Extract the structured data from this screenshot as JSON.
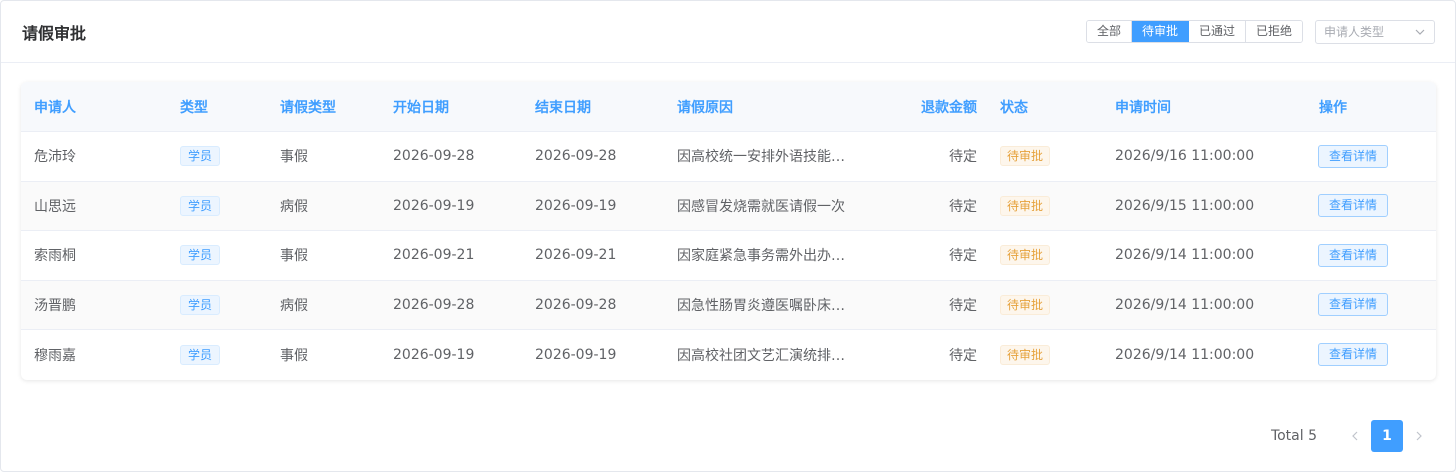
{
  "header": {
    "title": "请假审批",
    "filters": [
      {
        "label": "全部",
        "active": false
      },
      {
        "label": "待审批",
        "active": true
      },
      {
        "label": "已通过",
        "active": false
      },
      {
        "label": "已拒绝",
        "active": false
      }
    ],
    "select_placeholder": "申请人类型"
  },
  "table": {
    "columns": [
      "申请人",
      "类型",
      "请假类型",
      "开始日期",
      "结束日期",
      "请假原因",
      "退款金额",
      "状态",
      "申请时间",
      "操作"
    ],
    "rows": [
      {
        "applicant": "危沛玲",
        "type": "学员",
        "leave_type": "事假",
        "start": "2026-09-28",
        "end": "2026-09-28",
        "reason": "因高校统一安排外语技能竞赛活动",
        "refund": "待定",
        "status": "待审批",
        "time": "2026/9/16 11:00:00",
        "action": "查看详情"
      },
      {
        "applicant": "山思远",
        "type": "学员",
        "leave_type": "病假",
        "start": "2026-09-19",
        "end": "2026-09-19",
        "reason": "因感冒发烧需就医请假一次",
        "refund": "待定",
        "status": "待审批",
        "time": "2026/9/15 11:00:00",
        "action": "查看详情"
      },
      {
        "applicant": "索雨桐",
        "type": "学员",
        "leave_type": "事假",
        "start": "2026-09-21",
        "end": "2026-09-21",
        "reason": "因家庭紧急事务需外出办理相关手续",
        "refund": "待定",
        "status": "待审批",
        "time": "2026/9/14 11:00:00",
        "action": "查看详情"
      },
      {
        "applicant": "汤晋鹏",
        "type": "学员",
        "leave_type": "病假",
        "start": "2026-09-28",
        "end": "2026-09-28",
        "reason": "因急性肠胃炎遵医嘱卧床休息",
        "refund": "待定",
        "status": "待审批",
        "time": "2026/9/14 11:00:00",
        "action": "查看详情"
      },
      {
        "applicant": "穆雨嘉",
        "type": "学员",
        "leave_type": "事假",
        "start": "2026-09-19",
        "end": "2026-09-19",
        "reason": "因高校社团文艺汇演统排冲突",
        "refund": "待定",
        "status": "待审批",
        "time": "2026/9/14 11:00:00",
        "action": "查看详情"
      }
    ]
  },
  "pagination": {
    "total_label": "Total 5",
    "current_page": "1"
  },
  "colors": {
    "primary": "#409eff",
    "warning": "#e6a23c",
    "text": "#606266"
  }
}
